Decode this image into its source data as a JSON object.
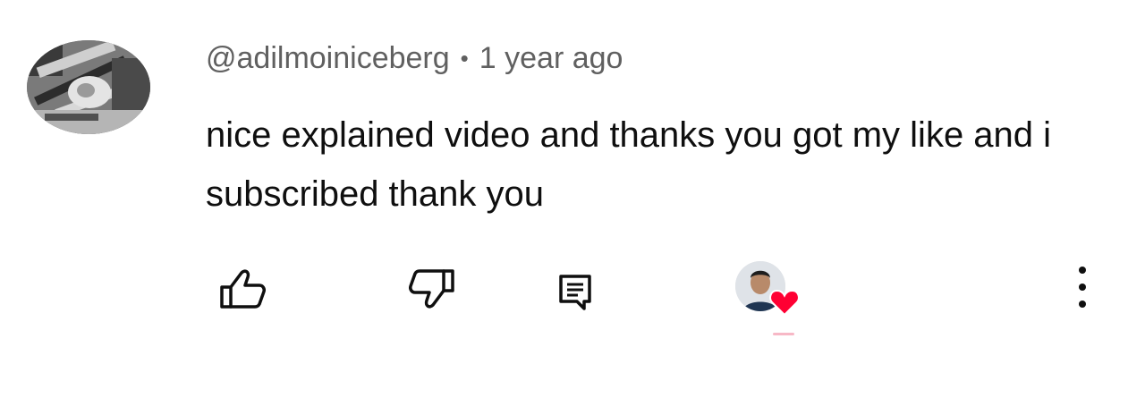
{
  "comment": {
    "author": "@adilmoiniceberg",
    "separator": "•",
    "timestamp": "1 year ago",
    "text": "nice explained video and thanks you got my like and i subscribed thank you"
  },
  "actions": {
    "like_icon": "thumbs-up-icon",
    "dislike_icon": "thumbs-down-icon",
    "reply_icon": "comment-icon",
    "hearted_icon": "heart-icon",
    "more_icon": "more-vertical-icon"
  },
  "colors": {
    "text": "#0f0f0f",
    "secondary_text": "#606060",
    "heart": "#ff0033"
  }
}
